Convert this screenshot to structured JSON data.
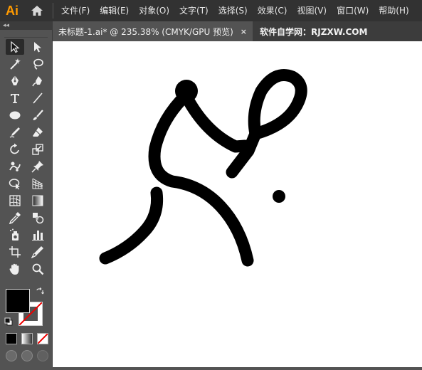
{
  "app": {
    "logo": "Ai"
  },
  "menu": {
    "items": [
      {
        "label": "文件(F)"
      },
      {
        "label": "编辑(E)"
      },
      {
        "label": "对象(O)"
      },
      {
        "label": "文字(T)"
      },
      {
        "label": "选择(S)"
      },
      {
        "label": "效果(C)"
      },
      {
        "label": "视图(V)"
      },
      {
        "label": "窗口(W)"
      },
      {
        "label": "帮助(H)"
      }
    ]
  },
  "toolpanel": {
    "collapse_glyph": "◂◂"
  },
  "tabs": {
    "active": {
      "title": "未标题-1.ai* @ 235.38% (CMYK/GPU 预览)",
      "close": "×"
    },
    "second": {
      "title": "软件自学网：RJZXW.COM"
    }
  },
  "tools": [
    {
      "icon": "selection-tool-icon"
    },
    {
      "icon": "direct-selection-tool-icon"
    },
    {
      "icon": "magic-wand-tool-icon"
    },
    {
      "icon": "lasso-tool-icon"
    },
    {
      "icon": "pen-tool-icon"
    },
    {
      "icon": "curvature-tool-icon"
    },
    {
      "icon": "type-tool-icon"
    },
    {
      "icon": "line-segment-tool-icon"
    },
    {
      "icon": "ellipse-tool-icon"
    },
    {
      "icon": "paintbrush-tool-icon"
    },
    {
      "icon": "shaper-tool-icon"
    },
    {
      "icon": "eraser-tool-icon"
    },
    {
      "icon": "rotate-tool-icon"
    },
    {
      "icon": "scale-tool-icon"
    },
    {
      "icon": "puppet-warp-tool-icon"
    },
    {
      "icon": "pin-tool-icon"
    },
    {
      "icon": "shape-builder-tool-icon"
    },
    {
      "icon": "perspective-grid-tool-icon"
    },
    {
      "icon": "mesh-tool-icon"
    },
    {
      "icon": "gradient-tool-icon"
    },
    {
      "icon": "eyedropper-tool-icon"
    },
    {
      "icon": "blend-tool-icon"
    },
    {
      "icon": "symbol-sprayer-tool-icon"
    },
    {
      "icon": "column-graph-tool-icon"
    },
    {
      "icon": "artboard-tool-icon"
    },
    {
      "icon": "slice-tool-icon"
    },
    {
      "icon": "hand-tool-icon"
    },
    {
      "icon": "zoom-tool-icon"
    }
  ],
  "colors": {
    "fill": "#000000",
    "stroke": "none",
    "accent_logo": "#ff9a00",
    "menubar_bg": "#323232",
    "panel_bg": "#535353"
  }
}
